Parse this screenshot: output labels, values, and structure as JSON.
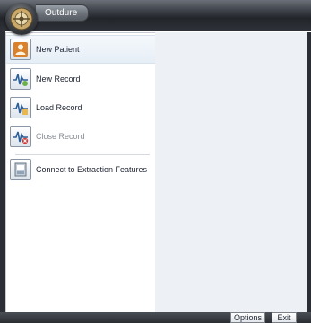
{
  "app": {
    "tab_label": "Outdure",
    "orb_icon": "app-orb-icon"
  },
  "menu": {
    "items": [
      {
        "label": "New Patient",
        "icon": "new-patient-icon",
        "enabled": true,
        "selected": true
      },
      {
        "label": "New Record",
        "icon": "new-record-icon",
        "enabled": true,
        "selected": false
      },
      {
        "label": "Load Record",
        "icon": "load-record-icon",
        "enabled": true,
        "selected": false
      },
      {
        "label": "Close Record",
        "icon": "close-record-icon",
        "enabled": false,
        "selected": false
      },
      {
        "label": "Connect to Extraction Features",
        "icon": "connect-icon",
        "enabled": true,
        "selected": false
      }
    ]
  },
  "footer": {
    "options_label": "Options",
    "exit_label": "Exit"
  },
  "colors": {
    "accent_blue": "#3a6ea8",
    "pane_bg": "#edf1f6",
    "chrome_dark": "#2b2f35"
  }
}
